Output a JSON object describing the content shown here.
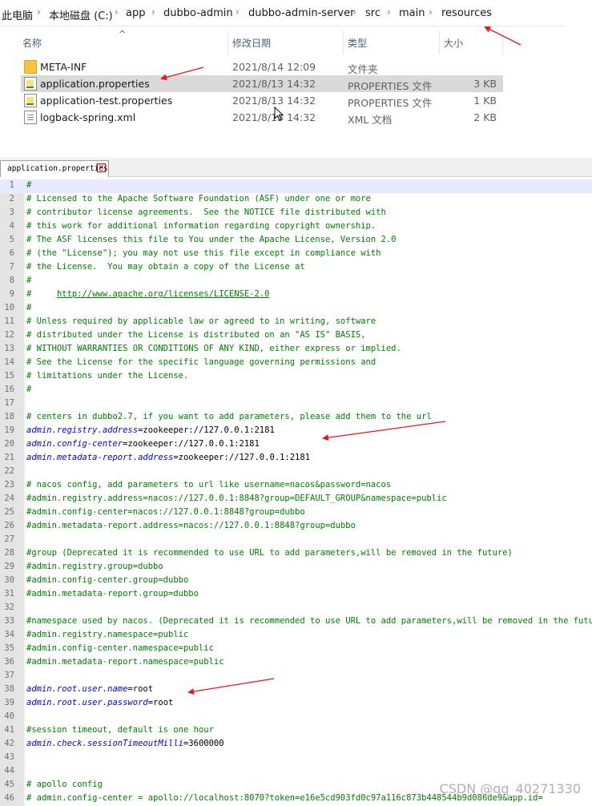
{
  "breadcrumb": [
    "此电脑",
    "本地磁盘 (C:)",
    "app",
    "dubbo-admin",
    "dubbo-admin-server",
    "src",
    "main",
    "resources"
  ],
  "columns": {
    "name": "名称",
    "date": "修改日期",
    "type": "类型",
    "size": "大小"
  },
  "files": [
    {
      "name": "META-INF",
      "date": "2021/8/14 12:09",
      "type": "文件夹",
      "size": "",
      "icon": "folder-icon"
    },
    {
      "name": "application.properties",
      "date": "2021/8/13 14:32",
      "type": "PROPERTIES 文件",
      "size": "3 KB",
      "icon": "properties-file-icon",
      "selected": true
    },
    {
      "name": "application-test.properties",
      "date": "2021/8/13 14:32",
      "type": "PROPERTIES 文件",
      "size": "1 KB",
      "icon": "properties-file-icon"
    },
    {
      "name": "logback-spring.xml",
      "date": "2021/8/13 14:32",
      "type": "XML 文档",
      "size": "2 KB",
      "icon": "xml-file-icon"
    }
  ],
  "editor": {
    "tab_label": "application.properties",
    "lines": [
      "#",
      "# Licensed to the Apache Software Foundation (ASF) under one or more",
      "# contributor license agreements.  See the NOTICE file distributed with",
      "# this work for additional information regarding copyright ownership.",
      "# The ASF licenses this file to You under the Apache License, Version 2.0",
      "# (the \"License\"); you may not use this file except in compliance with",
      "# the License.  You may obtain a copy of the License at",
      "#",
      "#     http://www.apache.org/licenses/LICENSE-2.0",
      "#",
      "# Unless required by applicable law or agreed to in writing, software",
      "# distributed under the License is distributed on an \"AS IS\" BASIS,",
      "# WITHOUT WARRANTIES OR CONDITIONS OF ANY KIND, either express or implied.",
      "# See the License for the specific language governing permissions and",
      "# limitations under the License.",
      "#",
      "",
      "# centers in dubbo2.7, if you want to add parameters, please add them to the url",
      "admin.registry.address=zookeeper://127.0.0.1:2181",
      "admin.config-center=zookeeper://127.0.0.1:2181",
      "admin.metadata-report.address=zookeeper://127.0.0.1:2181",
      "",
      "# nacos config, add parameters to url like username=nacos&password=nacos",
      "#admin.registry.address=nacos://127.0.0.1:8848?group=DEFAULT_GROUP&namespace=public",
      "#admin.config-center=nacos://127.0.0.1:8848?group=dubbo",
      "#admin.metadata-report.address=nacos://127.0.0.1:8848?group=dubbo",
      "",
      "#group (Deprecated it is recommended to use URL to add parameters,will be removed in the future)",
      "#admin.registry.group=dubbo",
      "#admin.config-center.group=dubbo",
      "#admin.metadata-report.group=dubbo",
      "",
      "#namespace used by nacos. (Deprecated it is recommended to use URL to add parameters,will be removed in the future)",
      "#admin.registry.namespace=public",
      "#admin.config-center.namespace=public",
      "#admin.metadata-report.namespace=public",
      "",
      "admin.root.user.name=root",
      "admin.root.user.password=root",
      "",
      "#session timeout, default is one hour",
      "admin.check.sessionTimeoutMilli=3600000",
      "",
      "",
      "# apollo config",
      "# admin.config-center = apollo://localhost:8070?token=e16e5cd903fd0c97a116c873b448544b9d086de9&app.id="
    ]
  },
  "watermark": "CSDN @qq_40271330",
  "colors": {
    "comment": "#008000",
    "key": "#0000ff",
    "value": "#000000",
    "gutter": "#e4e4e4",
    "arrow": "#e8161c",
    "selection": "#d9d9d9"
  }
}
